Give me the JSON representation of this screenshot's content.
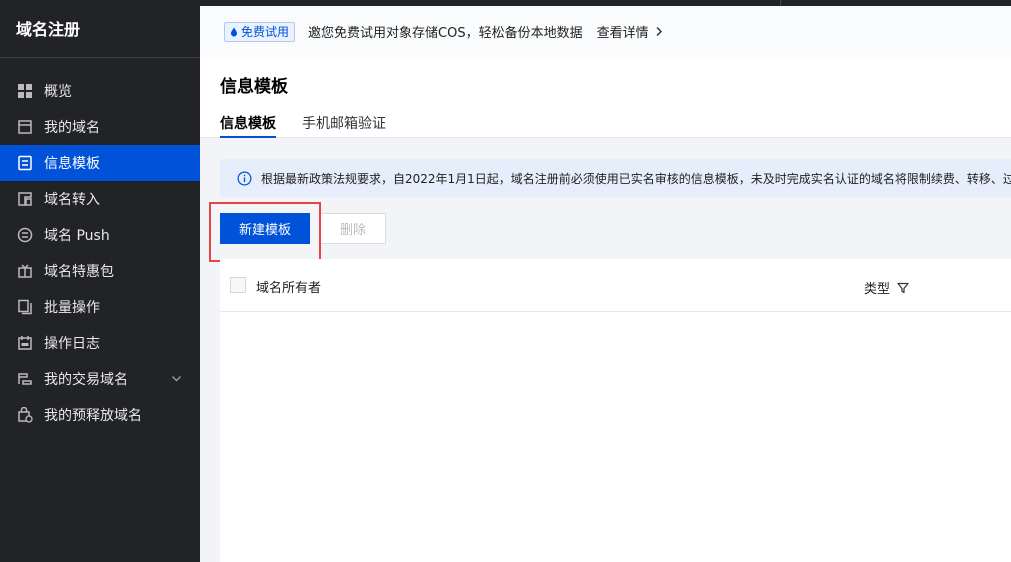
{
  "sidebar": {
    "title": "域名注册",
    "items": [
      {
        "label": "概览",
        "icon": "dashboard-grid-icon"
      },
      {
        "label": "我的域名",
        "icon": "calendar-box-icon"
      },
      {
        "label": "信息模板",
        "icon": "document-template-icon",
        "active": true
      },
      {
        "label": "域名转入",
        "icon": "transfer-in-icon"
      },
      {
        "label": "域名 Push",
        "icon": "push-circle-icon"
      },
      {
        "label": "域名特惠包",
        "icon": "gift-box-icon"
      },
      {
        "label": "批量操作",
        "icon": "batch-copy-icon"
      },
      {
        "label": "操作日志",
        "icon": "calendar-log-icon"
      },
      {
        "label": "我的交易域名",
        "icon": "trade-domain-icon",
        "expandable": true
      },
      {
        "label": "我的预释放域名",
        "icon": "pre-release-lock-icon"
      }
    ]
  },
  "promo": {
    "badge": "免费试用",
    "text": "邀您免费试用对象存储COS，轻松备份本地数据",
    "link": "查看详情"
  },
  "header": {
    "title": "信息模板",
    "tabs": [
      {
        "label": "信息模板",
        "active": true
      },
      {
        "label": "手机邮箱验证",
        "active": false
      }
    ]
  },
  "notice": {
    "text": "根据最新政策法规要求，自2022年1月1日起，域名注册前必须使用已实名审核的信息模板，未及时完成实名认证的域名将限制续费、转移、过户"
  },
  "toolbar": {
    "create_label": "新建模板",
    "delete_label": "删除"
  },
  "table": {
    "columns": [
      "域名所有者",
      "类型"
    ]
  },
  "colors": {
    "accent": "#0052d9",
    "sidebar_bg": "#222326",
    "highlight": "#e54545"
  }
}
